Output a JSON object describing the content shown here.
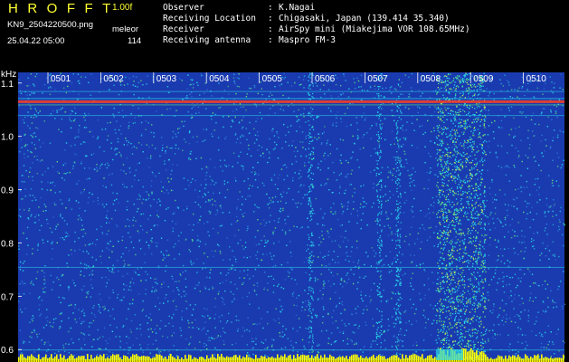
{
  "header": {
    "title": "HROFFT",
    "version": "1.00f",
    "filename": "KN9_2504220500.png",
    "mode_label": "meleor",
    "datetime": "25.04.22 05:00",
    "count": "114",
    "meta": [
      {
        "key": "Observer",
        "value": "K.Nagai"
      },
      {
        "key": "Receiving Location",
        "value": "Chigasaki, Japan (139.414 35.340)"
      },
      {
        "key": "Receiver",
        "value": "AirSpy mini (Miakejima VOR 108.65MHz)"
      },
      {
        "key": "Receiving antenna",
        "value": "Maspro FM-3"
      }
    ],
    "separator": ":"
  },
  "chart_data": {
    "type": "heatmap",
    "y_unit": "kHz",
    "x_ticks": [
      "0501",
      "0502",
      "0503",
      "0504",
      "0505",
      "0506",
      "0507",
      "0508",
      "0509",
      "0510"
    ],
    "y_ticks": [
      "1.1",
      "1.0",
      "0.9",
      "0.8",
      "0.7",
      "0.6"
    ],
    "ylim": [
      0.58,
      1.12
    ],
    "colors": {
      "background": "#1a3bb0",
      "noise_cyan": "#27d6e8",
      "noise_green": "#5fe07a",
      "carrier": "#ff4020",
      "footer_bar": "#ffff00",
      "grid": "#7a8fd8"
    }
  }
}
